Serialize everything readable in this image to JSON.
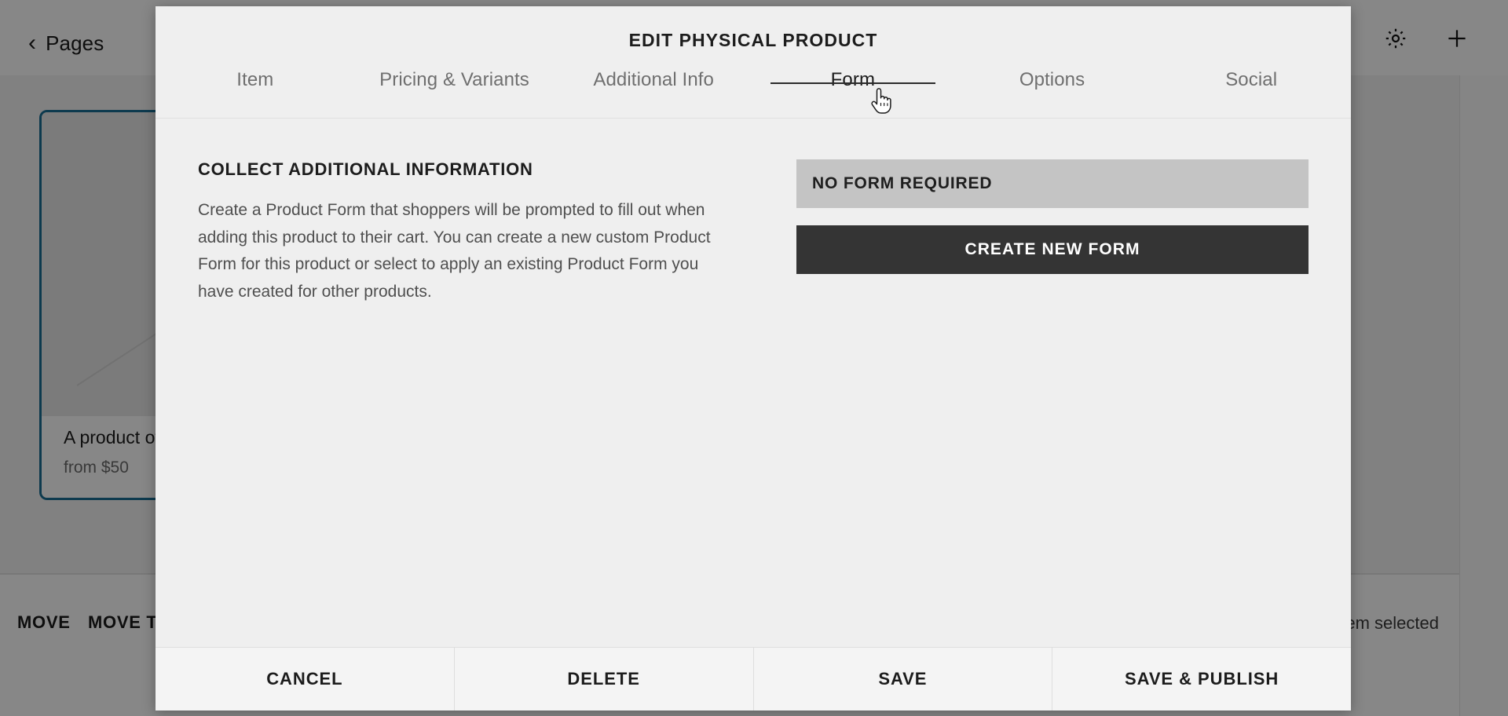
{
  "background": {
    "back_link": {
      "label": "Pages",
      "icon": "chevron-left-icon"
    },
    "topbar_icons": [
      {
        "name": "gear-icon"
      },
      {
        "name": "plus-icon"
      }
    ],
    "product_card": {
      "title": "A product of s",
      "price": "from $50"
    },
    "bottom_bar": {
      "move_label": "MOVE",
      "move_to_label": "MOVE TO",
      "selection_status": "em selected"
    }
  },
  "modal": {
    "title": "EDIT PHYSICAL PRODUCT",
    "tabs": [
      {
        "label": "Item",
        "active": false
      },
      {
        "label": "Pricing & Variants",
        "active": false
      },
      {
        "label": "Additional Info",
        "active": false
      },
      {
        "label": "Form",
        "active": true
      },
      {
        "label": "Options",
        "active": false
      },
      {
        "label": "Social",
        "active": false
      }
    ],
    "form_panel": {
      "heading": "COLLECT ADDITIONAL INFORMATION",
      "body": "Create a Product Form that shoppers will be prompted to fill out when adding this product to their cart. You can create a new custom Product Form for this product or select to apply an existing Product Form you have created for other products.",
      "form_select_value": "NO FORM REQUIRED",
      "create_button_label": "CREATE NEW FORM"
    },
    "footer": [
      {
        "label": "CANCEL"
      },
      {
        "label": "DELETE"
      },
      {
        "label": "SAVE"
      },
      {
        "label": "SAVE & PUBLISH"
      }
    ]
  },
  "colors": {
    "modal_background": "#efefef",
    "select_background": "#c4c4c4",
    "primary_button": "#343434",
    "card_selection_border": "#1a6f94",
    "active_tab_underline": "#2b2b2b"
  }
}
